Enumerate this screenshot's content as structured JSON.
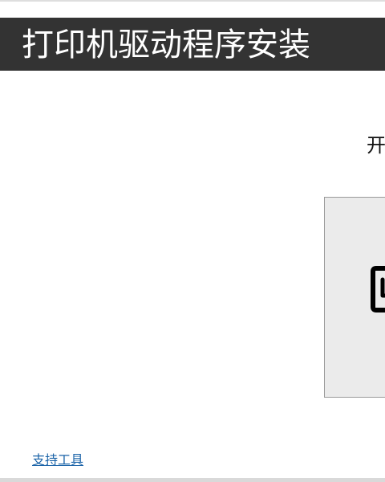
{
  "header": {
    "title": "打印机驱动程序安装"
  },
  "main": {
    "start_text": "开",
    "printer_tile": {
      "icon": "printer-icon"
    }
  },
  "footer": {
    "support_link": "支持工具"
  },
  "colors": {
    "header_bg": "#333333",
    "header_text": "#ffffff",
    "tile_bg": "#ebebeb",
    "link": "#1a63a8"
  }
}
